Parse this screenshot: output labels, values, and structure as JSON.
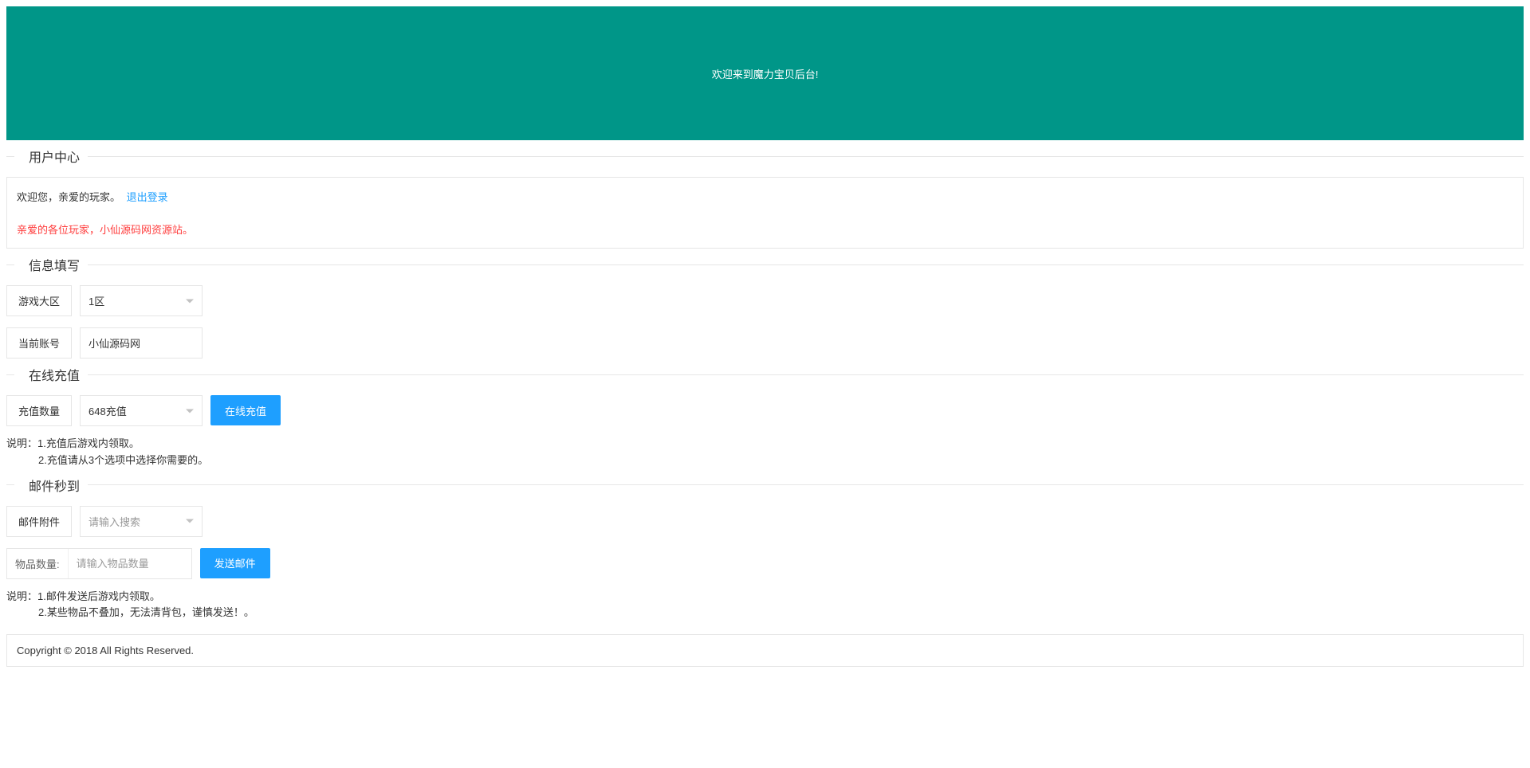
{
  "banner": {
    "text": "欢迎来到魔力宝贝后台!"
  },
  "userCenter": {
    "legend": "用户中心",
    "welcome": "欢迎您，亲爱的玩家。",
    "logout": "退出登录",
    "notice": "亲爱的各位玩家，小仙源码网资源站。"
  },
  "infoForm": {
    "legend": "信息填写",
    "zoneLabel": "游戏大区",
    "zoneValue": "1区",
    "accountLabel": "当前账号",
    "accountValue": "小仙源码网"
  },
  "recharge": {
    "legend": "在线充值",
    "amountLabel": "充值数量",
    "amountValue": "648充值",
    "button": "在线充值",
    "descPrefix": "说明：",
    "desc1": "1.充值后游戏内领取。",
    "desc2": "2.充值请从3个选项中选择你需要的。"
  },
  "mail": {
    "legend": "邮件秒到",
    "attachLabel": "邮件附件",
    "attachPlaceholder": "请输入搜索",
    "qtyLabel": "物品数量:",
    "qtyPlaceholder": "请输入物品数量",
    "button": "发送邮件",
    "descPrefix": "说明：",
    "desc1": "1.邮件发送后游戏内领取。",
    "desc2": "2.某些物品不叠加，无法清背包，谨慎发送！。"
  },
  "footer": {
    "copyright": "Copyright © 2018 All Rights Reserved."
  }
}
